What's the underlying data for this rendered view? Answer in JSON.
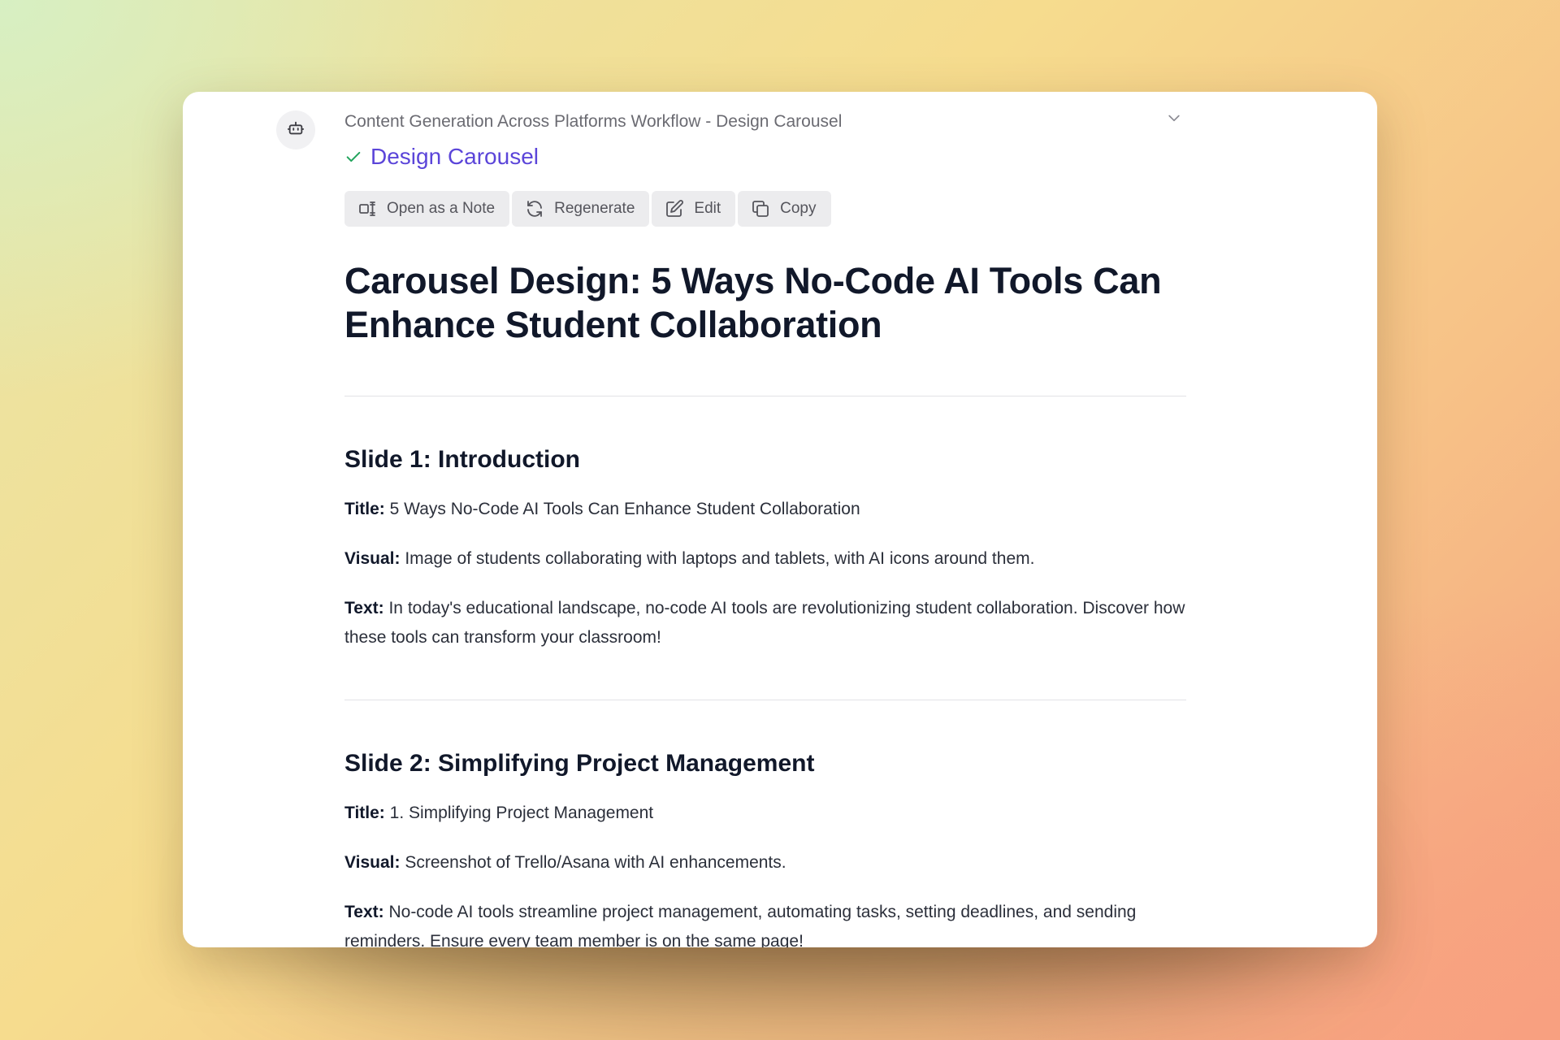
{
  "header": {
    "breadcrumb": "Content Generation Across Platforms Workflow - Design Carousel",
    "step_title": "Design Carousel"
  },
  "toolbar": {
    "open_note": "Open as a Note",
    "regenerate": "Regenerate",
    "edit": "Edit",
    "copy": "Copy"
  },
  "doc": {
    "title": "Carousel Design: 5 Ways No-Code AI Tools Can Enhance Student Collaboration",
    "slides": [
      {
        "heading": "Slide 1: Introduction",
        "title_label": "Title:",
        "title_value": "5 Ways No-Code AI Tools Can Enhance Student Collaboration",
        "visual_label": "Visual:",
        "visual_value": "Image of students collaborating with laptops and tablets, with AI icons around them.",
        "text_label": "Text:",
        "text_value": "In today's educational landscape, no-code AI tools are revolutionizing student collaboration. Discover how these tools can transform your classroom!"
      },
      {
        "heading": "Slide 2: Simplifying Project Management",
        "title_label": "Title:",
        "title_value": "1. Simplifying Project Management",
        "visual_label": "Visual:",
        "visual_value": "Screenshot of Trello/Asana with AI enhancements.",
        "text_label": "Text:",
        "text_value": "No-code AI tools streamline project management, automating tasks, setting deadlines, and sending reminders. Ensure every team member is on the same page!"
      }
    ]
  },
  "colors": {
    "accent": "#5b45d9",
    "success": "#22a45d",
    "heading": "#11182a"
  },
  "icons": [
    "bot-icon",
    "chevron-down-icon",
    "check-icon",
    "note-icon",
    "refresh-icon",
    "edit-icon",
    "copy-icon"
  ]
}
